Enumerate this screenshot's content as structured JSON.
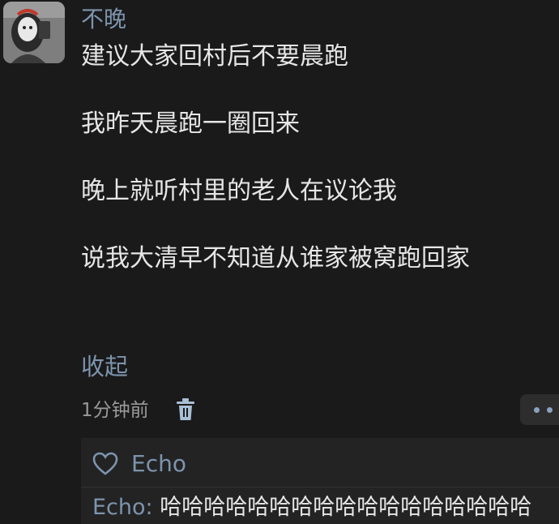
{
  "post": {
    "author": "不晚",
    "lines": [
      "建议大家回村后不要晨跑",
      "我昨天晨跑一圈回来",
      "晚上就听村里的老人在议论我",
      "说我大清早不知道从谁家被窝跑回家"
    ],
    "collapse_label": "收起",
    "timestamp": "1分钟前"
  },
  "icons": {
    "delete": "trash-icon",
    "more": "more-icon",
    "like": "heart-icon"
  },
  "likes": {
    "name": "Echo"
  },
  "reply": {
    "author": "Echo",
    "separator": ": ",
    "text": "哈哈哈哈哈哈哈哈哈哈哈哈哈哈哈哈哈"
  },
  "colors": {
    "background": "#1a1a1a",
    "link": "#7d94ad",
    "text": "#e6e6e6",
    "muted": "#9a9a9a"
  }
}
